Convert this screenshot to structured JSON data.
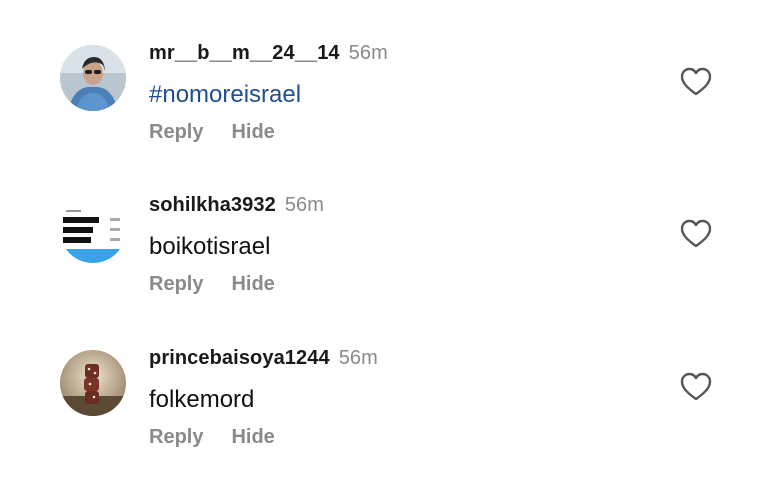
{
  "comments": [
    {
      "username": "mr__b__m__24__14",
      "time": "56m",
      "text": "#nomoreisrael",
      "reply_label": "Reply",
      "hide_label": "Hide"
    },
    {
      "username": "sohilkha3932",
      "time": "56m",
      "text": "boikotisrael",
      "reply_label": "Reply",
      "hide_label": "Hide"
    },
    {
      "username": "princebaisoya1244",
      "time": "56m",
      "text": "folkemord",
      "reply_label": "Reply",
      "hide_label": "Hide"
    }
  ],
  "icons": {
    "like": "heart-outline-icon"
  },
  "colors": {
    "hashtag": "#1f4f8f",
    "muted": "#8a8a8a",
    "text": "#111111"
  }
}
